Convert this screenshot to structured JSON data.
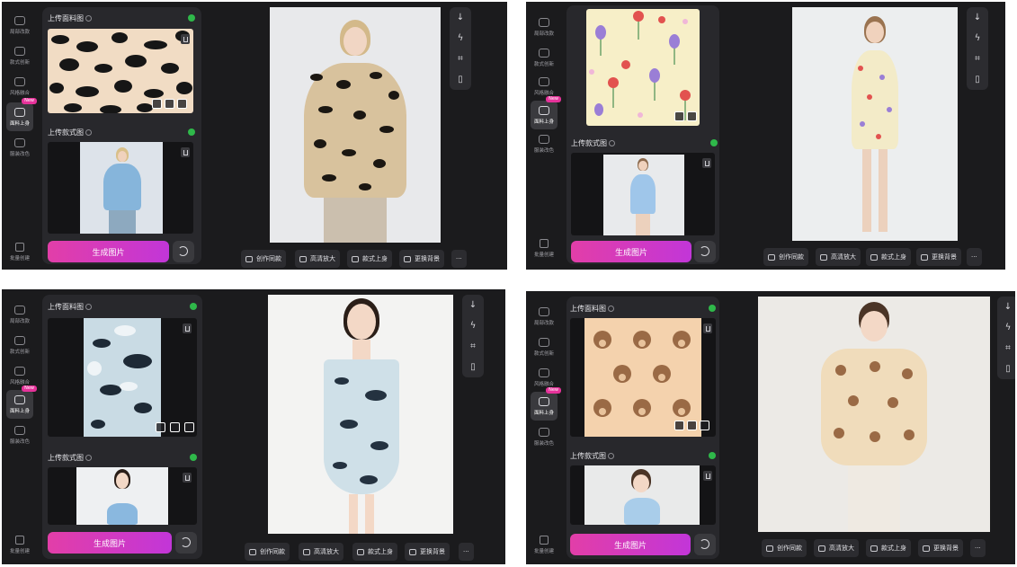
{
  "sidebar": {
    "items": [
      {
        "label": "局部改款",
        "icon": "edit-area-icon"
      },
      {
        "label": "款式创新",
        "icon": "shirt-icon"
      },
      {
        "label": "风格融合",
        "icon": "merge-circles-icon"
      },
      {
        "label": "面料上身",
        "icon": "fabric-icon",
        "badge": "New"
      },
      {
        "label": "服装改色",
        "icon": "palette-icon"
      }
    ],
    "batch_label": "批量创建"
  },
  "upload_fabric_title": "上传面料图",
  "upload_style_title": "上传款式图",
  "generate_label": "生成图片",
  "actions": [
    "创作同款",
    "高清放大",
    "款式上身",
    "更换背景"
  ],
  "more_label": "···",
  "tool_icons": [
    "download-icon",
    "flash-icon",
    "crop-scan-icon",
    "trash-icon"
  ],
  "colors": {
    "accent": "#e23ea8",
    "check": "#2fb84a",
    "panel": "#1b1b1d"
  },
  "panels": [
    {
      "fabric": "leopard",
      "outfit": "leopard-shirt"
    },
    {
      "fabric": "tulip-floral",
      "outfit": "floral-dress"
    },
    {
      "fabric": "ink-tie-dye",
      "outfit": "tie-dye-dress"
    },
    {
      "fabric": "bear-print",
      "outfit": "bear-puffer"
    }
  ]
}
